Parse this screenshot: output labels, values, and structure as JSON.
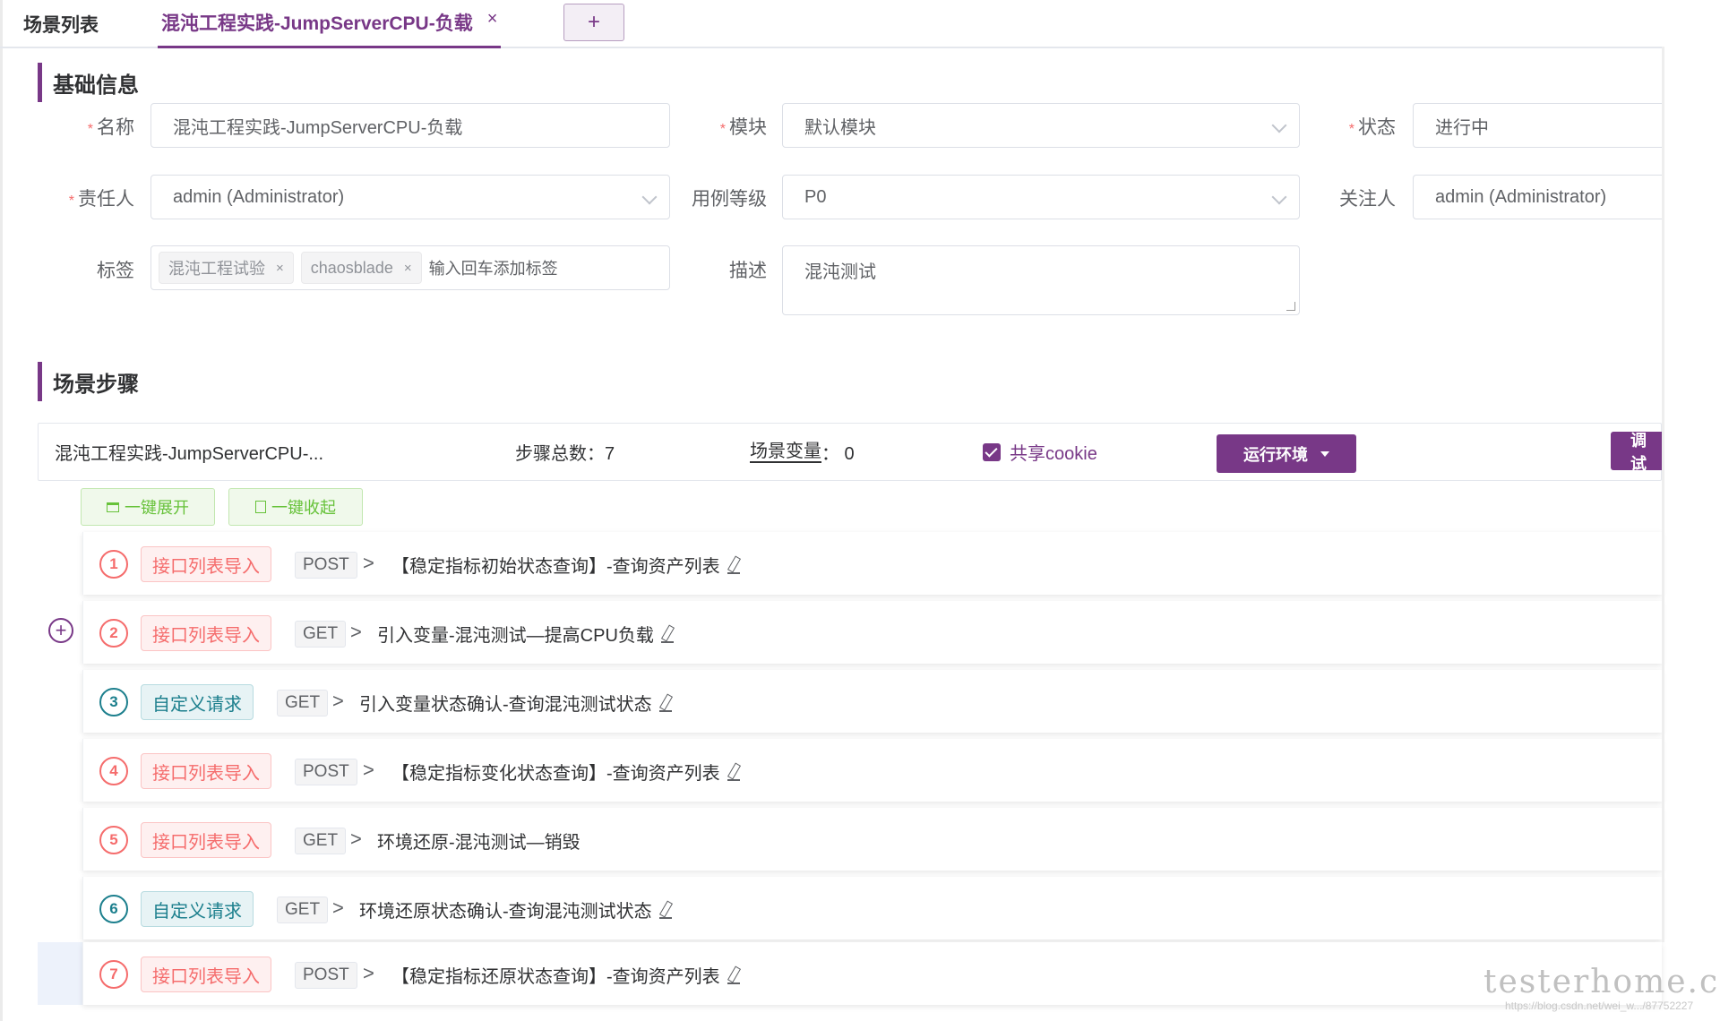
{
  "tabs": {
    "list_label": "场景列表",
    "active_label": "混沌工程实践-JumpServerCPU-负载",
    "close_icon": "×",
    "add_icon": "+"
  },
  "sections": {
    "basic_info": "基础信息",
    "scenario_steps": "场景步骤"
  },
  "form": {
    "name_label": "名称",
    "name_value": "混沌工程实践-JumpServerCPU-负载",
    "module_label": "模块",
    "module_value": "默认模块",
    "status_label": "状态",
    "status_value": "进行中",
    "owner_label": "责任人",
    "owner_value": "admin (Administrator)",
    "level_label": "用例等级",
    "level_value": "P0",
    "follower_label": "关注人",
    "follower_value": "admin (Administrator)",
    "tags_label": "标签",
    "tags": [
      "混沌工程试验",
      "chaosblade"
    ],
    "tag_close": "×",
    "tag_placeholder": "输入回车添加标签",
    "desc_label": "描述",
    "desc_value": "混沌测试",
    "required_mark": "*"
  },
  "summary": {
    "scenario_name": "混沌工程实践-JumpServerCPU-...",
    "step_total": "步骤总数：7",
    "var_label": "场景变量",
    "var_value": "： 0",
    "share_cookie": "共享cookie",
    "run_env": "运行环境",
    "debug": "调试"
  },
  "controls": {
    "expand_all": "一键展开",
    "collapse_all": "一键收起"
  },
  "steps": [
    {
      "num": "1",
      "type": "接口列表导入",
      "method": "POST",
      "name": "【稳定指标初始状态查询】-查询资产列表"
    },
    {
      "num": "2",
      "type": "接口列表导入",
      "method": "GET",
      "name": "引入变量-混沌测试—提高CPU负载"
    },
    {
      "num": "3",
      "type": "自定义请求",
      "method": "GET",
      "name": "引入变量状态确认-查询混沌测试状态"
    },
    {
      "num": "4",
      "type": "接口列表导入",
      "method": "POST",
      "name": "【稳定指标变化状态查询】-查询资产列表"
    },
    {
      "num": "5",
      "type": "接口列表导入",
      "method": "GET",
      "name": "环境还原-混沌测试—销毁"
    },
    {
      "num": "6",
      "type": "自定义请求",
      "method": "GET",
      "name": "环境还原状态确认-查询混沌测试状态"
    },
    {
      "num": "7",
      "type": "接口列表导入",
      "method": "POST",
      "name": "【稳定指标还原状态查询】-查询资产列表"
    }
  ],
  "arrow_glyph": ">",
  "add_step_icon": "+",
  "watermark": "testerhome.com",
  "watermark_sub": "https://blog.csdn.net/wei_w.../87752227",
  "colors": {
    "accent": "#783887",
    "import_red": "#f56c6c",
    "custom_teal": "#1c7f8d",
    "expand_green": "#67c23a"
  }
}
